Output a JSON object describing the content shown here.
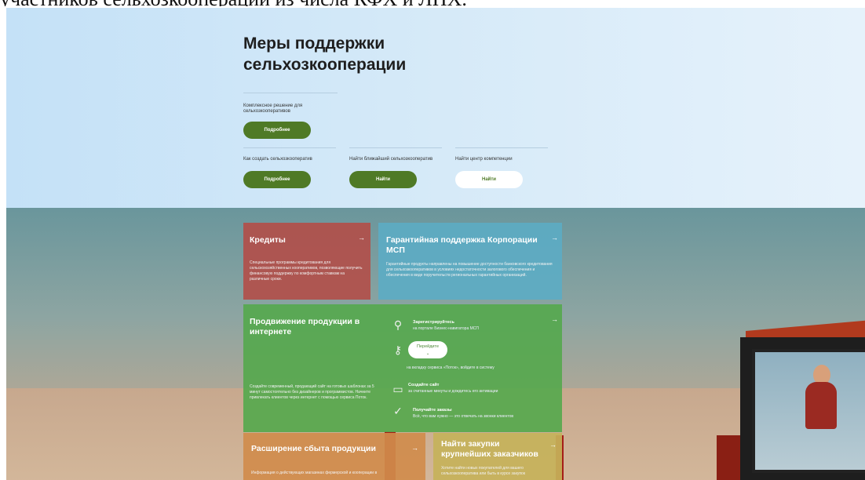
{
  "caption": "участников сельхозкооперации из числа КФХ и ЛПХ.",
  "hero": {
    "title_line1": "Меры поддержки",
    "title_line2": "сельхозкооперации",
    "complex_text": "Комплексное решение для сельхозкооперативов",
    "more1": "Подробнее",
    "how_create": "Как создать сельхозкооператив",
    "more2": "Подробнее",
    "find_nearest": "Найти ближайший сельхозкооператив",
    "find1": "Найти",
    "find_center": "Найти центр компетенции",
    "find2": "Найти"
  },
  "tiles": {
    "credits": {
      "title": "Кредиты",
      "text": "Специальные программы кредитования для сельскохозяйственных кооперативов, позволяющие получить финансовую поддержку по комфортным ставкам на различные сроки."
    },
    "guarantee": {
      "title": "Гарантийная поддержка Корпорации МСП",
      "text": "Гарантийные продукты направлены на повышение доступности банковского кредитования для сельхозкооперативов в условиях недостаточности залогового обеспечения и обеспечения в виде поручительств региональных гарантийных организаций."
    },
    "promo": {
      "title": "Продвижение продукции в интернете",
      "text": "Создайте современный, продающий сайт на готовых шаблонах за 5 минут самостоятельно без дизайнеров и программистов. Начните привлекать клиентов через интернет с помощью сервиса Поток.",
      "step1_title": "Зарегистрируйтесь",
      "step1_sub": "на портале Бизнес-навигатора МСП",
      "go": "Перейдите",
      "step2_sub": "на вкладку сервиса «Поток», войдите в систему",
      "step3_title": "Создайте сайт",
      "step3_sub": "за считанные минуты и дождитесь его активации",
      "step4_title": "Получайте заказы",
      "step4_sub": "Всё, что вам нужно — это отвечать на звонки клиентов"
    },
    "sales": {
      "title": "Расширение сбыта продукции",
      "text": "Информация о действующих магазинах фермерской и кооперации в"
    },
    "purchases": {
      "title_line1": "Найти закупки",
      "title_line2": "крупнейших заказчиков",
      "text": "Хотите найти новых покупателей для вашего сельхозкооператива или быть в курсе закупок"
    }
  },
  "arrow": "→",
  "colors": {
    "brand_green": "#4f7a26",
    "credits": "#b24e48",
    "guarantee": "#5cacc4",
    "promo": "#54a84c",
    "sales": "#d08c4c",
    "purchases": "#c6b25a"
  },
  "icons": [
    "person-key-icon",
    "key-icon",
    "laptop-icon",
    "check-icon"
  ]
}
